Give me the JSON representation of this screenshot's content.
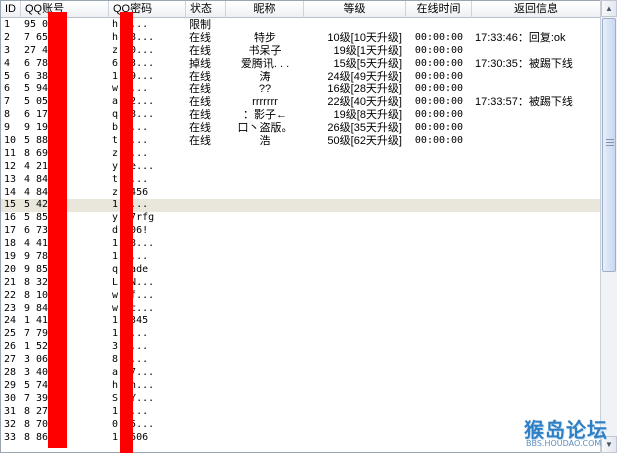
{
  "headers": [
    "ID",
    "QQ账号",
    "QQ密码",
    "状态",
    "昵称",
    "等级",
    "在线时间",
    "返回信息"
  ],
  "rows": [
    {
      "id": "1",
      "qq": "95    00",
      "pw": "h     8...",
      "status": "限制",
      "nick": "",
      "level": "",
      "online": "",
      "msg": ""
    },
    {
      "id": "2",
      "qq": "7     653",
      "pw": "h     98...",
      "status": "在线",
      "nick": "特步",
      "level": "10级[10天升级]",
      "online": "00:00:00",
      "msg": "17:33:46：回复:ok"
    },
    {
      "id": "3",
      "qq": "27    416",
      "pw": "z     80...",
      "status": "在线",
      "nick": "书呆子",
      "level": "19级[1天升级]",
      "online": "00:00:00",
      "msg": ""
    },
    {
      "id": "4",
      "qq": "6     787",
      "pw": "6     23...",
      "status": "掉线",
      "nick": "爱腾讯. . .",
      "level": "15级[5天升级]",
      "online": "00:00:00",
      "msg": "17:30:35：被踢下线"
    },
    {
      "id": "5",
      "qq": "6     380",
      "pw": "1     59...",
      "status": "在线",
      "nick": "涛",
      "level": "24级[49天升级]",
      "online": "00:00:00",
      "msg": ""
    },
    {
      "id": "6",
      "qq": "5     948",
      "pw": "w     i...",
      "status": "在线",
      "nick": "??",
      "level": "16级[28天升级]",
      "online": "00:00:00",
      "msg": ""
    },
    {
      "id": "7",
      "qq": "5     050",
      "pw": "a     52...",
      "status": "在线",
      "nick": "rrrrrrr",
      "level": "22级[40天升级]",
      "online": "00:00:00",
      "msg": "17:33:57：被踢下线"
    },
    {
      "id": "8",
      "qq": "6     177",
      "pw": "q     08...",
      "status": "在线",
      "nick": "：影子←",
      "level": "19级[8天升级]",
      "online": "00:00:00",
      "msg": ""
    },
    {
      "id": "9",
      "qq": "9     198",
      "pw": "b     u...",
      "status": "在线",
      "nick": "口丶盗版。",
      "level": "26级[35天升级]",
      "online": "00:00:00",
      "msg": ""
    },
    {
      "id": "10",
      "qq": "5     885",
      "pw": "t     u...",
      "status": "在线",
      "nick": "浩",
      "level": "50级[62天升级]",
      "online": "00:00:00",
      "msg": ""
    },
    {
      "id": "11",
      "qq": "8     699",
      "pw": "z     u...",
      "status": "",
      "nick": "",
      "level": "",
      "online": "",
      "msg": ""
    },
    {
      "id": "12",
      "qq": "4     211",
      "pw": "y     fe...",
      "status": "",
      "nick": "",
      "level": "",
      "online": "",
      "msg": ""
    },
    {
      "id": "13",
      "qq": "4     8458",
      "pw": "t     6...",
      "status": "",
      "nick": "",
      "level": "",
      "online": "",
      "msg": ""
    },
    {
      "id": "14",
      "qq": "4     8475",
      "pw": "z     3456",
      "status": "",
      "nick": "",
      "level": "",
      "online": "",
      "msg": ""
    },
    {
      "id": "15",
      "qq": "5     429",
      "pw": "1     2...",
      "status": "",
      "nick": "",
      "level": "",
      "online": "",
      "msg": ""
    },
    {
      "id": "16",
      "qq": "5     85",
      "pw": "y     47rfg",
      "status": "",
      "nick": "",
      "level": "",
      "online": "",
      "msg": ""
    },
    {
      "id": "17",
      "qq": "6     737",
      "pw": "d     006!",
      "status": "",
      "nick": "",
      "level": "",
      "online": "",
      "msg": ""
    },
    {
      "id": "18",
      "qq": "4     418",
      "pw": "1     58...",
      "status": "",
      "nick": "",
      "level": "",
      "online": "",
      "msg": ""
    },
    {
      "id": "19",
      "qq": "9     781",
      "pw": "1     5...",
      "status": "",
      "nick": "",
      "level": "",
      "online": "",
      "msg": ""
    },
    {
      "id": "20",
      "qq": "9     853",
      "pw": "q     made",
      "status": "",
      "nick": "",
      "level": "",
      "online": "",
      "msg": ""
    },
    {
      "id": "21",
      "qq": "8     324",
      "pw": "L     AN...",
      "status": "",
      "nick": "",
      "level": "",
      "online": "",
      "msg": ""
    },
    {
      "id": "22",
      "qq": "8     107",
      "pw": "w     sf...",
      "status": "",
      "nick": "",
      "level": "",
      "online": "",
      "msg": ""
    },
    {
      "id": "23",
      "qq": "9     845",
      "pw": "w     .c...",
      "status": "",
      "nick": "",
      "level": "",
      "online": "",
      "msg": ""
    },
    {
      "id": "24",
      "qq": "1     412",
      "pw": "1     2345",
      "status": "",
      "nick": "",
      "level": "",
      "online": "",
      "msg": ""
    },
    {
      "id": "25",
      "qq": "7     791",
      "pw": "1     2...",
      "status": "",
      "nick": "",
      "level": "",
      "online": "",
      "msg": ""
    },
    {
      "id": "26",
      "qq": "1     520",
      "pw": "3     8...",
      "status": "",
      "nick": "",
      "level": "",
      "online": "",
      "msg": ""
    },
    {
      "id": "27",
      "qq": "3     069",
      "pw": "8     2...",
      "status": "",
      "nick": "",
      "level": "",
      "online": "",
      "msg": ""
    },
    {
      "id": "28",
      "qq": "3     406",
      "pw": "a     97...",
      "status": "",
      "nick": "",
      "level": "",
      "online": "",
      "msg": ""
    },
    {
      "id": "29",
      "qq": "5     743",
      "pw": "h     sh...",
      "status": "",
      "nick": "",
      "level": "",
      "online": "",
      "msg": ""
    },
    {
      "id": "30",
      "qq": "7     391",
      "pw": "S     SY...",
      "status": "",
      "nick": "",
      "level": "",
      "online": "",
      "msg": ""
    },
    {
      "id": "31",
      "qq": "8     270",
      "pw": "1     1...",
      "status": "",
      "nick": "",
      "level": "",
      "online": "",
      "msg": ""
    },
    {
      "id": "32",
      "qq": "8     702",
      "pw": "0     35...",
      "status": "",
      "nick": "",
      "level": "",
      "online": "",
      "msg": ""
    },
    {
      "id": "33",
      "qq": "8     863",
      "pw": "1     0606",
      "status": "",
      "nick": "",
      "level": "",
      "online": "",
      "msg": ""
    }
  ],
  "selected_row": 15,
  "scrollbar": {
    "up_icon": "up-arrow-icon",
    "down_icon": "down-arrow-icon"
  },
  "watermark": {
    "main": "猴岛论坛",
    "sub": "BBS.HOUDAO.COM"
  },
  "colors": {
    "redaction": "#ff0000",
    "selected_row": "#e9e7dc",
    "watermark": "#2f7fc4"
  }
}
